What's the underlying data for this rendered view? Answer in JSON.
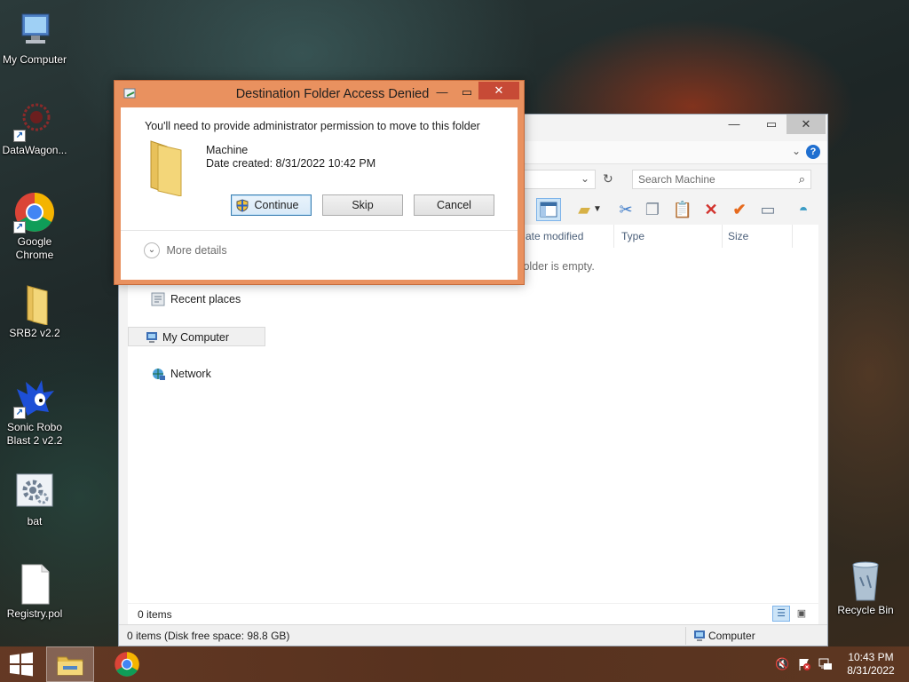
{
  "desktop": {
    "icons": [
      {
        "label": "My Computer"
      },
      {
        "label": "DataWagon..."
      },
      {
        "label": "Google Chrome"
      },
      {
        "label": "SRB2 v2.2"
      },
      {
        "label": "Sonic Robo Blast 2 v2.2"
      },
      {
        "label": "bat"
      },
      {
        "label": "Registry.pol"
      },
      {
        "label": "Recycle Bin"
      }
    ]
  },
  "explorer": {
    "search_placeholder": "Search Machine",
    "columns": [
      "ate modified",
      "Type",
      "Size"
    ],
    "empty_message": "folder is empty.",
    "nav": [
      "Recent places",
      "My Computer",
      "Network"
    ],
    "item_count": "0 items",
    "status_left": "0 items (Disk free space: 98.8 GB)",
    "status_right": "Computer"
  },
  "dialog": {
    "title": "Destination Folder Access Denied",
    "message": "You'll need to provide administrator permission to move to this folder",
    "folder_name": "Machine",
    "date_created": "Date created: 8/31/2022 10:42 PM",
    "continue_label": "Continue",
    "skip_label": "Skip",
    "cancel_label": "Cancel",
    "more_details": "More details"
  },
  "taskbar": {
    "time": "10:43 PM",
    "date": "8/31/2022"
  },
  "colors": {
    "dialog_frame": "#e9915f",
    "taskbar": "#693a24",
    "help_icon": "#1f6fd0"
  }
}
